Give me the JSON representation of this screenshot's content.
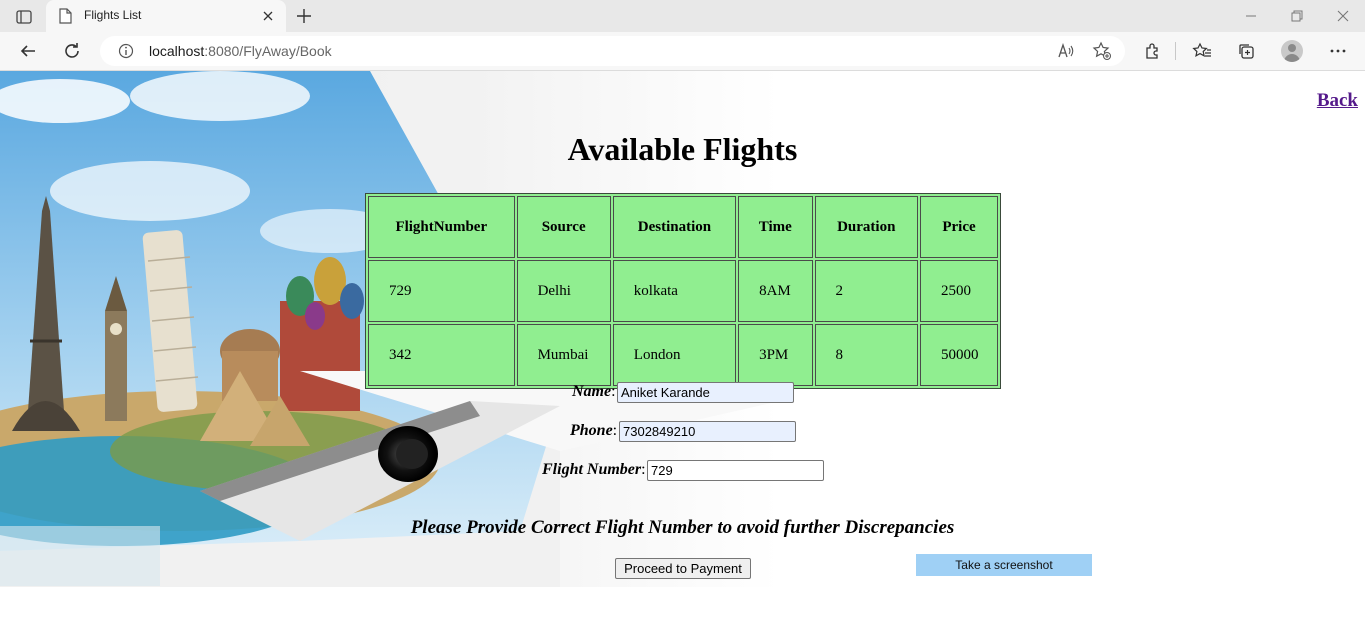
{
  "browser": {
    "tab_title": "Flights List",
    "url_host": "localhost",
    "url_path": ":8080/FlyAway/Book"
  },
  "page": {
    "back_link": "Back",
    "heading": "Available Flights",
    "table": {
      "headers": [
        "FlightNumber",
        "Source",
        "Destination",
        "Time",
        "Duration",
        "Price"
      ],
      "rows": [
        [
          "729",
          "Delhi",
          "kolkata",
          "8AM",
          "2",
          "2500"
        ],
        [
          "342",
          "Mumbai",
          "London",
          "3PM",
          "8",
          "50000"
        ]
      ]
    },
    "form": {
      "name_label": "Name",
      "name_value": "Aniket Karande",
      "phone_label": "Phone",
      "phone_value": "7302849210",
      "flight_label": "Flight Number",
      "flight_value": "729",
      "colon": ":"
    },
    "note": "Please Provide Correct Flight Number to avoid further Discrepancies",
    "proceed_button": "Proceed to Payment",
    "screenshot_button": "Take a screenshot"
  },
  "colors": {
    "table_bg": "#90ee90",
    "link": "#551a8b",
    "autofill": "#e8f0fe",
    "screenshot_btn": "#9fd0f5"
  }
}
